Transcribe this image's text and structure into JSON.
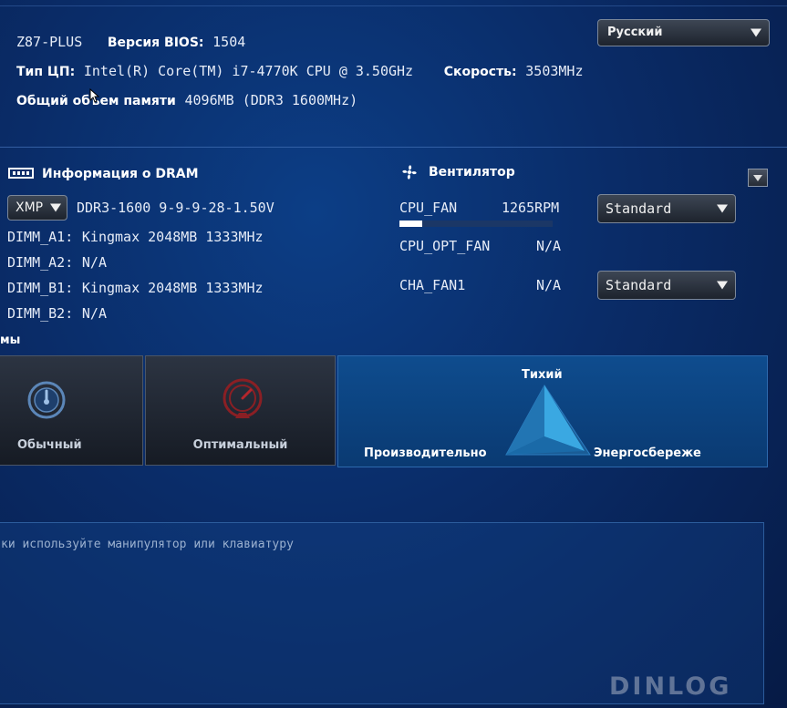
{
  "header": {
    "model": "Z87-PLUS",
    "bios_label": "Версия BIOS:",
    "bios_value": "1504",
    "cpu_label": "Тип ЦП:",
    "cpu_value": "Intel(R) Core(TM) i7-4770K CPU @ 3.50GHz",
    "speed_label": "Скорость:",
    "speed_value": "3503MHz",
    "memory_label": "Общий объем памяти",
    "memory_value": "4096MB (DDR3 1600MHz)",
    "language": "Русский"
  },
  "dram": {
    "title": "Информация о DRAM",
    "profile_select": "XMP",
    "profile_value": "DDR3-1600 9-9-9-28-1.50V",
    "slots": [
      {
        "label": "DIMM_A1:",
        "value": "Kingmax 2048MB 1333MHz"
      },
      {
        "label": "DIMM_A2:",
        "value": "N/A"
      },
      {
        "label": "DIMM_B1:",
        "value": "Kingmax 2048MB 1333MHz"
      },
      {
        "label": "DIMM_B2:",
        "value": "N/A"
      }
    ]
  },
  "fans": {
    "title": "Вентилятор",
    "items": [
      {
        "name": "CPU_FAN",
        "speed": "1265RPM",
        "mode": "Standard",
        "bar_fraction": 0.15
      },
      {
        "name": "CPU_OPT_FAN",
        "speed": "N/A"
      },
      {
        "name": "CHA_FAN1",
        "speed": "N/A",
        "mode": "Standard"
      }
    ]
  },
  "system_modes": {
    "section_title_partial": "мы",
    "modes": [
      {
        "label": "Обычный"
      },
      {
        "label": "Оптимальный"
      }
    ],
    "triangle": {
      "top": "Тихий",
      "left": "Производительно",
      "right": "Энергосбереже"
    }
  },
  "boot": {
    "hint": "ки используйте манипулятор или клавиатуру"
  },
  "watermark": "DINLOG"
}
